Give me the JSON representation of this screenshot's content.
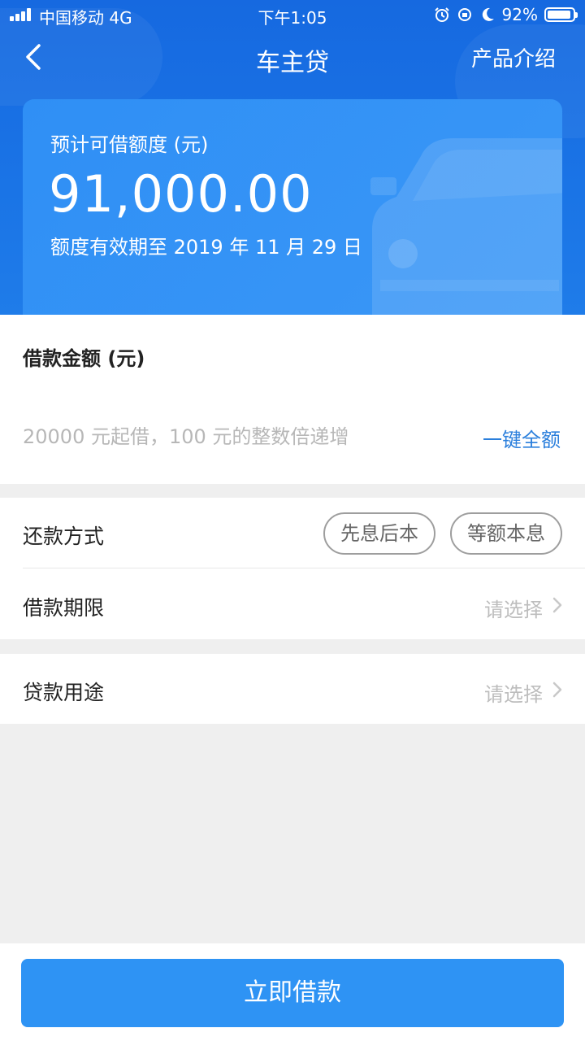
{
  "status_bar": {
    "carrier": "中国移动 4G",
    "time": "下午1:05",
    "battery": "92%",
    "battery_level": 0.92
  },
  "nav": {
    "title": "车主贷",
    "right_link": "产品介绍"
  },
  "quota_card": {
    "label": "预计可借额度 (元)",
    "amount": "91,000.00",
    "validity": "额度有效期至 2019 年 11 月 29 日"
  },
  "loan_amount": {
    "title": "借款金额 (元)",
    "input_value": "",
    "placeholder": "20000 元起借，100 元的整数倍递增",
    "fill_all_label": "一键全额"
  },
  "repayment": {
    "label": "还款方式",
    "options": [
      "先息后本",
      "等额本息"
    ]
  },
  "term": {
    "label": "借款期限",
    "value": "请选择"
  },
  "purpose": {
    "label": "贷款用途",
    "value": "请选择"
  },
  "submit_label": "立即借款",
  "colors": {
    "brand_blue": "#1a74e6",
    "button_blue": "#2e93f4",
    "link_blue": "#2b7fdc"
  }
}
